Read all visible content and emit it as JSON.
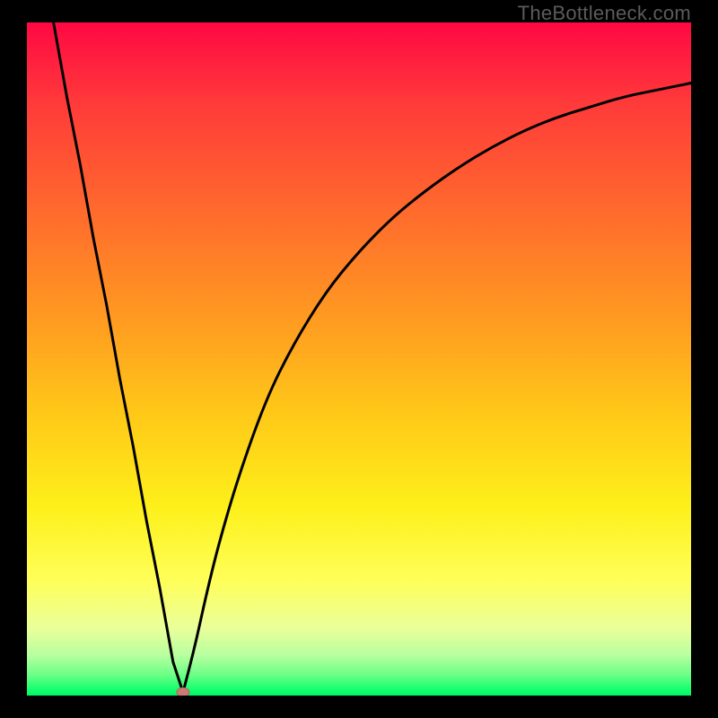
{
  "watermark": "TheBottleneck.com",
  "chart_data": {
    "type": "line",
    "title": "",
    "xlabel": "",
    "ylabel": "",
    "xlim": [
      0,
      100
    ],
    "ylim": [
      0,
      100
    ],
    "grid": false,
    "legend": false,
    "background": "gradient:red-to-green-vertical",
    "series": [
      {
        "name": "left-branch",
        "x": [
          4,
          6,
          8,
          10,
          12,
          14,
          16,
          18,
          20,
          22,
          23.5
        ],
        "y": [
          100,
          89,
          79,
          68,
          58,
          47,
          37,
          26,
          16,
          5,
          0.5
        ]
      },
      {
        "name": "right-branch",
        "x": [
          23.5,
          25,
          27,
          29,
          32,
          36,
          40,
          45,
          50,
          55,
          60,
          65,
          70,
          75,
          80,
          85,
          90,
          95,
          100
        ],
        "y": [
          0.5,
          6,
          15,
          23,
          33,
          44,
          52,
          60,
          66,
          71,
          75,
          78.5,
          81.5,
          84,
          86,
          87.5,
          89,
          90,
          91
        ]
      }
    ],
    "marker": {
      "x": 23.5,
      "y": 0.5,
      "color": "#cc7a74",
      "name": "optimal-point"
    }
  }
}
